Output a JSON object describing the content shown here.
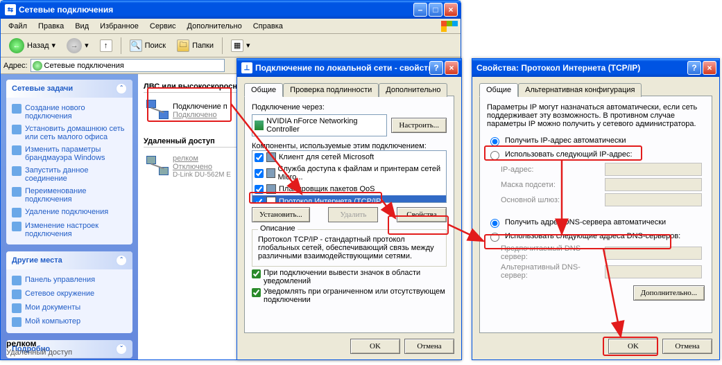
{
  "explorer": {
    "title": "Сетевые подключения",
    "menus": [
      "Файл",
      "Правка",
      "Вид",
      "Избранное",
      "Сервис",
      "Дополнительно",
      "Справка"
    ],
    "toolbar": {
      "back": "Назад",
      "search": "Поиск",
      "folders": "Папки"
    },
    "address_label": "Адрес:",
    "address_value": "Сетевые подключения",
    "side": {
      "box1_title": "Сетевые задачи",
      "box1_links": [
        "Создание нового подключения",
        "Установить домашнюю сеть или сеть малого офиса",
        "Изменить параметры брандмауэра Windows",
        "Запустить данное соединение",
        "Переименование подключения",
        "Удаление подключения",
        "Изменение настроек подключения"
      ],
      "box2_title": "Другие места",
      "box2_links": [
        "Панель управления",
        "Сетевое окружение",
        "Мои документы",
        "Мой компьютер"
      ],
      "box3_title": "Подробно"
    },
    "content": {
      "group1": "ЛВС или высокоскоросн",
      "conn1_name": "Подключение п",
      "conn1_status": "Подключено",
      "group2": "Удаленный доступ",
      "conn2_name": "релком",
      "conn2_status": "Отключено",
      "conn2_device": "D-Link DU-562M E"
    },
    "details": {
      "name": "релком",
      "sub": "Удаленный доступ"
    }
  },
  "dlg1": {
    "title": "Подключение по локальной сети - свойства",
    "tabs": [
      "Общие",
      "Проверка подлинности",
      "Дополнительно"
    ],
    "connect_via": "Подключение через:",
    "adapter": "NVIDIA nForce Networking Controller",
    "configure": "Настроить...",
    "components_label": "Компоненты, используемые этим подключением:",
    "components": [
      "Клиент для сетей Microsoft",
      "Служба доступа к файлам и принтерам сетей Micro...",
      "Планировщик пакетов QoS",
      "Протокол Интернета (TCP/IP)"
    ],
    "install": "Установить...",
    "remove": "Удалить",
    "properties": "Свойства",
    "desc_title": "Описание",
    "desc_text": "Протокол TCP/IP - стандартный протокол глобальных сетей, обеспечивающий связь между различными взаимодействующими сетями.",
    "chk_tray": "При подключении вывести значок в области уведомлений",
    "chk_warn": "Уведомлять при ограниченном или отсутствующем подключении",
    "ok": "OK",
    "cancel": "Отмена"
  },
  "dlg2": {
    "title": "Свойства: Протокол Интернета (TCP/IP)",
    "tabs": [
      "Общие",
      "Альтернативная конфигурация"
    ],
    "intro": "Параметры IP могут назначаться автоматически, если сеть поддерживает эту возможность. В противном случае параметры IP можно получить у сетевого администратора.",
    "radio_auto_ip": "Получить IP-адрес автоматически",
    "radio_manual_ip": "Использовать следующий IP-адрес:",
    "ip_addr": "IP-адрес:",
    "mask": "Маска подсети:",
    "gateway": "Основной шлюз:",
    "radio_auto_dns": "Получить адрес DNS-сервера автоматически",
    "radio_manual_dns": "Использовать следующие адреса DNS-серверов:",
    "pref_dns": "Предпочитаемый DNS-сервер:",
    "alt_dns": "Альтернативный DNS-сервер:",
    "advanced": "Дополнительно...",
    "ok": "OK",
    "cancel": "Отмена"
  }
}
